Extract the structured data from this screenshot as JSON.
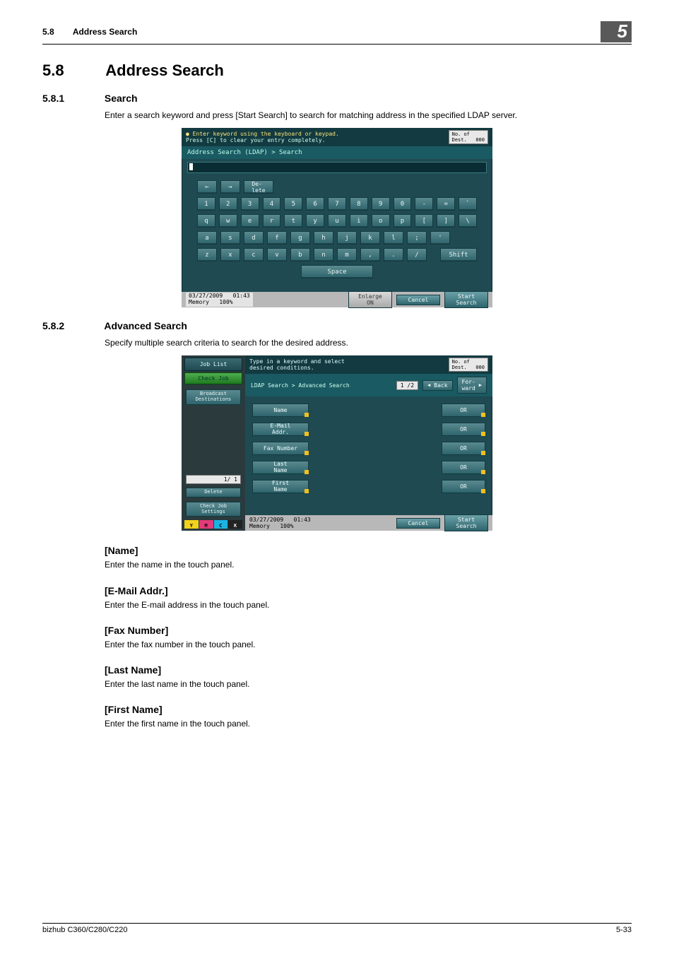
{
  "header": {
    "section_num": "5.8",
    "section_name": "Address Search",
    "chapter_badge": "5"
  },
  "h1": {
    "num": "5.8",
    "title": "Address Search"
  },
  "s581": {
    "num": "5.8.1",
    "title": "Search",
    "body": "Enter a search keyword and press [Start Search] to search for matching address in the specified LDAP server."
  },
  "shot1": {
    "hint_line1": "Enter keyword using the keyboard or keypad.",
    "hint_line2": "Press [C] to clear your entry completely.",
    "dest_label": "No. of\nDest.",
    "dest_count": "000",
    "breadcrumb": "Address Search (LDAP) > Search",
    "arrows": {
      "left": "←",
      "right": "→",
      "delete": "De-\nlete"
    },
    "row_num": [
      "1",
      "2",
      "3",
      "4",
      "5",
      "6",
      "7",
      "8",
      "9",
      "0",
      "-",
      "=",
      "`"
    ],
    "row_q": [
      "q",
      "w",
      "e",
      "r",
      "t",
      "y",
      "u",
      "i",
      "o",
      "p",
      "[",
      "]",
      "\\"
    ],
    "row_a": [
      "a",
      "s",
      "d",
      "f",
      "g",
      "h",
      "j",
      "k",
      "l",
      ";",
      "'"
    ],
    "row_z": [
      "z",
      "x",
      "c",
      "v",
      "b",
      "n",
      "m",
      ",",
      ".",
      "/"
    ],
    "shift": "Shift",
    "space": "Space",
    "footer_date": "03/27/2009",
    "footer_time": "01:43",
    "footer_mem": "Memory",
    "footer_mempct": "100%",
    "enlarge": "Enlarge\nON",
    "cancel": "Cancel",
    "start": "Start\nSearch"
  },
  "s582": {
    "num": "5.8.2",
    "title": "Advanced Search",
    "body": "Specify multiple search criteria to search for the desired address."
  },
  "shot2": {
    "left": {
      "job_list": "Job List",
      "check_job": "Check Job",
      "broadcast": "Broadcast\nDestinations",
      "count": "1/   1",
      "delete": "Delete",
      "check_settings": "Check Job\nSettings",
      "toners": [
        "Y",
        "M",
        "C",
        "K"
      ]
    },
    "top_hint": "Type in a keyword and select\ndesired conditions.",
    "dest_label": "No. of\nDest.",
    "dest_count": "000",
    "breadcrumb": "LDAP Search > Advanced Search",
    "page": "1 /2",
    "back": "Back",
    "forward": "For-\nward",
    "fields": [
      {
        "label": "Name",
        "cond": "OR"
      },
      {
        "label": "E-Mail\nAddr.",
        "cond": "OR"
      },
      {
        "label": "Fax Number",
        "cond": "OR"
      },
      {
        "label": "Last\nName",
        "cond": "OR"
      },
      {
        "label": "First\nName",
        "cond": "OR"
      }
    ],
    "footer_date": "03/27/2009",
    "footer_time": "01:43",
    "footer_mem": "Memory",
    "footer_mempct": "100%",
    "cancel": "Cancel",
    "start": "Start\nSearch"
  },
  "fields_doc": {
    "name_h": "[Name]",
    "name_b": "Enter the name in the touch panel.",
    "email_h": "[E-Mail Addr.]",
    "email_b": "Enter the E-mail address in the touch panel.",
    "fax_h": "[Fax Number]",
    "fax_b": "Enter the fax number in the touch panel.",
    "last_h": "[Last Name]",
    "last_b": "Enter the last name in the touch panel.",
    "first_h": "[First Name]",
    "first_b": "Enter the first name in the touch panel."
  },
  "footer": {
    "model": "bizhub C360/C280/C220",
    "page": "5-33"
  }
}
